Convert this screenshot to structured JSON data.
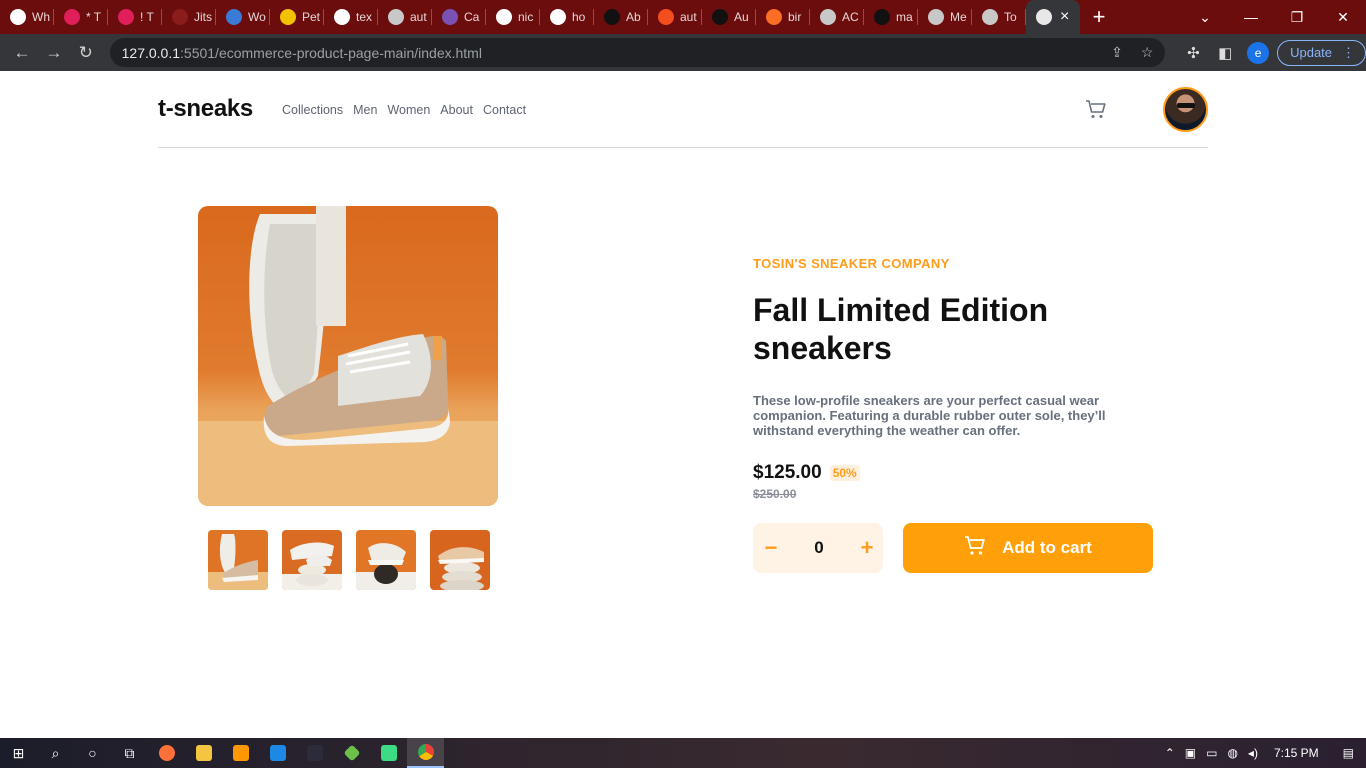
{
  "browser": {
    "tabs": [
      {
        "label": "Wh",
        "icon": "chrome-icon",
        "color": "#ffffff"
      },
      {
        "label": "* T",
        "icon": "slack-icon",
        "color": "#e01e5a"
      },
      {
        "label": "! T",
        "icon": "slack-icon",
        "color": "#e01e5a"
      },
      {
        "label": "Jits",
        "icon": "jitsi-icon",
        "color": "#8a1c1c"
      },
      {
        "label": "Wo",
        "icon": "link-icon",
        "color": "#3a7bd5"
      },
      {
        "label": "Pet",
        "icon": "pet-icon",
        "color": "#f2c200"
      },
      {
        "label": "tex",
        "icon": "google-icon",
        "color": "#ffffff"
      },
      {
        "label": "aut",
        "icon": "globe-icon",
        "color": "#c8c8c8"
      },
      {
        "label": "Ca",
        "icon": "bootstrap-icon",
        "color": "#7952b3"
      },
      {
        "label": "nic",
        "icon": "google-icon",
        "color": "#ffffff"
      },
      {
        "label": "ho",
        "icon": "google-icon",
        "color": "#ffffff"
      },
      {
        "label": "Ab",
        "icon": "ab-icon",
        "color": "#111111"
      },
      {
        "label": "aut",
        "icon": "figma-icon",
        "color": "#f24e1e"
      },
      {
        "label": "Au",
        "icon": "angular-icon",
        "color": "#111111"
      },
      {
        "label": "bir",
        "icon": "gitlab-icon",
        "color": "#fc6d26"
      },
      {
        "label": "AC",
        "icon": "globe-icon",
        "color": "#c8c8c8"
      },
      {
        "label": "ma",
        "icon": "github-icon",
        "color": "#111111"
      },
      {
        "label": "Me",
        "icon": "globe-icon",
        "color": "#c8c8c8"
      },
      {
        "label": "To",
        "icon": "globe-icon",
        "color": "#c8c8c8"
      }
    ],
    "url_host": "127.0.0.1",
    "url_path": ":5501/ecommerce-product-page-main/index.html",
    "update_label": "Update",
    "profile_letter": "e"
  },
  "site": {
    "logo": "t-sneaks",
    "nav": [
      "Collections",
      "Men",
      "Women",
      "About",
      "Contact"
    ]
  },
  "product": {
    "company": "TOSIN'S SNEAKER COMPANY",
    "title": "Fall Limited Edition sneakers",
    "description": "These low-profile sneakers are your perfect casual wear companion. Featuring a durable rubber outer sole, they’ll withstand everything the weather can offer.",
    "price": "$125.00",
    "discount": "50%",
    "old_price": "$250.00",
    "quantity": "0",
    "minus_symbol": "−",
    "plus_symbol": "+",
    "add_to_cart": "Add to cart",
    "accent_color": "#ff9c1a"
  },
  "taskbar": {
    "time": "7:15 PM"
  }
}
